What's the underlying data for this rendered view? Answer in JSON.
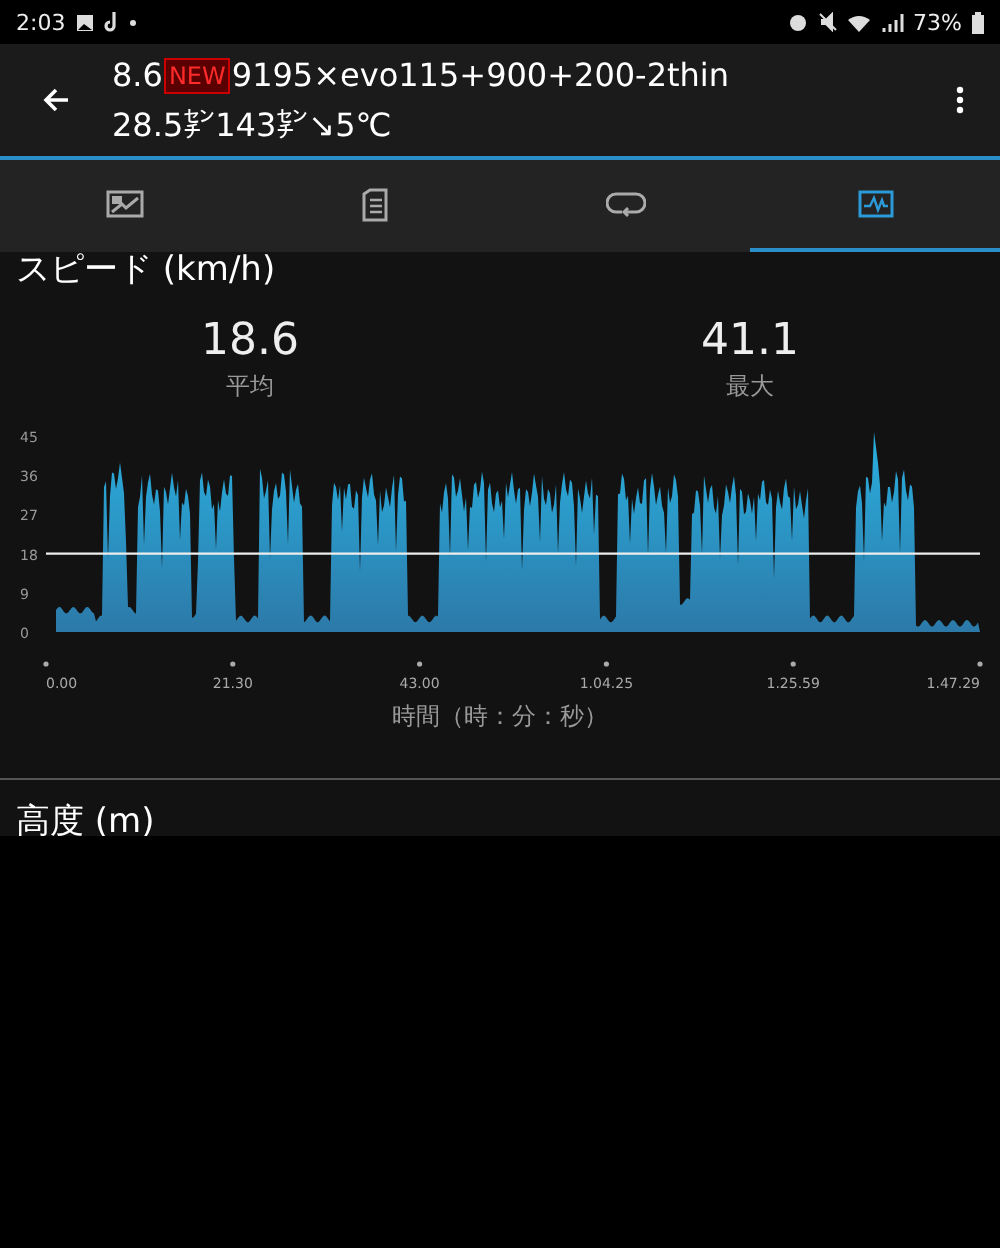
{
  "status_bar": {
    "time": "2:03",
    "battery": "73%"
  },
  "header": {
    "title_prefix": "8.6",
    "badge": "NEW",
    "title_rest": "9195×evo115+900+200-2thin",
    "subtitle": "28.5㌢143㌢↘5℃"
  },
  "tabs": [
    {
      "kind": "map",
      "selected": false
    },
    {
      "kind": "summary",
      "selected": false
    },
    {
      "kind": "laps",
      "selected": false
    },
    {
      "kind": "graph",
      "selected": true
    }
  ],
  "speed": {
    "title": "スピード (km/h)",
    "stats": [
      {
        "value": "18.6",
        "label": "平均"
      },
      {
        "value": "41.1",
        "label": "最大"
      }
    ],
    "y_ticks": [
      "45",
      "36",
      "27",
      "18",
      "9",
      "0"
    ],
    "x_ticks": [
      "0.00",
      "21.30",
      "43.00",
      "1.04.25",
      "1.25.59",
      "1.47.29"
    ],
    "x_label": "時間（時：分：秒）"
  },
  "next_section": {
    "title": "高度 (m)"
  }
}
